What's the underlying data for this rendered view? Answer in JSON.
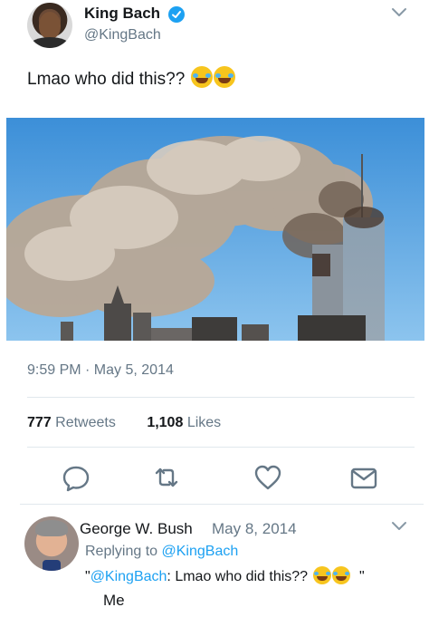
{
  "tweet": {
    "author": {
      "display_name": "King Bach",
      "handle": "@KingBach",
      "verified": true,
      "avatar": "profile-photo"
    },
    "text": "Lmao who did this??",
    "emojis": [
      "face-with-tears-of-joy",
      "face-with-tears-of-joy"
    ],
    "media": {
      "description": "photo"
    },
    "timestamp": "9:59 PM · May 5, 2014",
    "retweets": {
      "count": "777",
      "label": "Retweets"
    },
    "likes": {
      "count": "1,108",
      "label": "Likes"
    },
    "actions": [
      "reply-icon",
      "retweet-icon",
      "like-icon",
      "share-icon"
    ]
  },
  "reply": {
    "author": {
      "display_name": "George W. Bush",
      "avatar": "profile-photo"
    },
    "date": "May 8, 2014",
    "replying_to": {
      "prefix": "Replying to",
      "handle": "@KingBach"
    },
    "quote": {
      "open_quote": "\"",
      "mention": "@KingBach",
      "text": ": Lmao who did this??",
      "close_quote": "\""
    },
    "body": "Me"
  },
  "colors": {
    "accent": "#1da1f2",
    "secondary_text": "#657786",
    "divider": "#e1e8ed"
  }
}
